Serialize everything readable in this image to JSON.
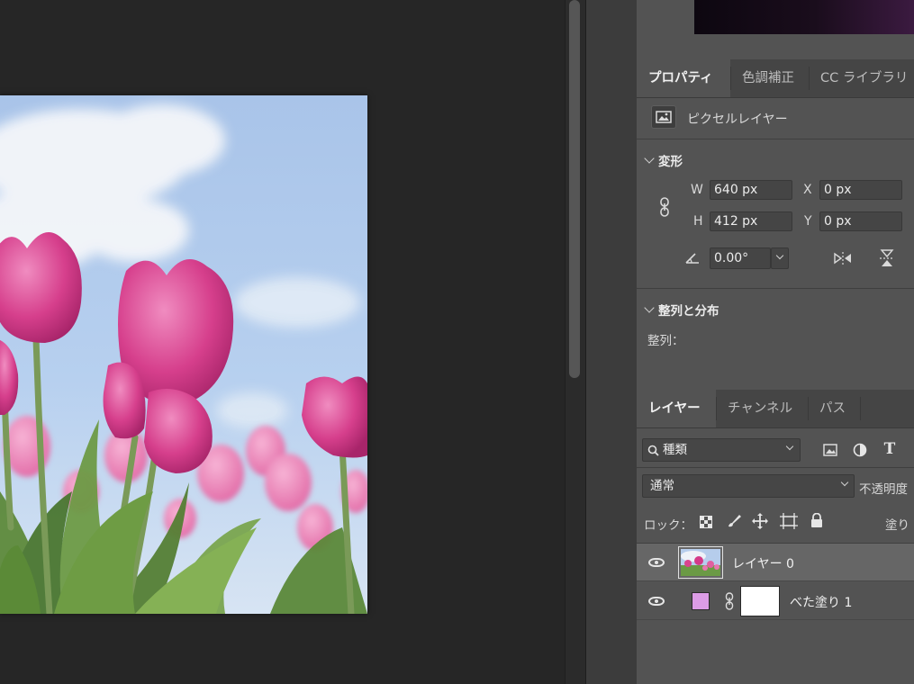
{
  "properties_tabs": [
    {
      "label": "プロパティ",
      "active": true
    },
    {
      "label": "色調補正",
      "active": false
    },
    {
      "label": "CC ライブラリ",
      "active": false
    }
  ],
  "layer_kind": "ピクセルレイヤー",
  "transform": {
    "title": "変形",
    "w_label": "W",
    "w_value": "640 px",
    "h_label": "H",
    "h_value": "412 px",
    "x_label": "X",
    "x_value": "0 px",
    "y_label": "Y",
    "y_value": "0 px",
    "angle_value": "0.00°"
  },
  "align": {
    "title": "整列と分布",
    "label": "整列："
  },
  "layers_tabs": [
    {
      "label": "レイヤー",
      "active": true
    },
    {
      "label": "チャンネル",
      "active": false
    },
    {
      "label": "パス",
      "active": false
    }
  ],
  "filter": {
    "label": "種類"
  },
  "blend": {
    "mode": "通常",
    "opacity_label": "不透明度"
  },
  "lock": {
    "label": "ロック：",
    "fill_label": "塗り"
  },
  "layers": [
    {
      "name": "レイヤー 0",
      "selected": true
    },
    {
      "name": "べた塗り 1",
      "selected": false,
      "swatch_color": "#dc9ce6"
    }
  ],
  "colors": {
    "accent_swatch": "#dc9ce6",
    "panel_bg": "#535353"
  }
}
